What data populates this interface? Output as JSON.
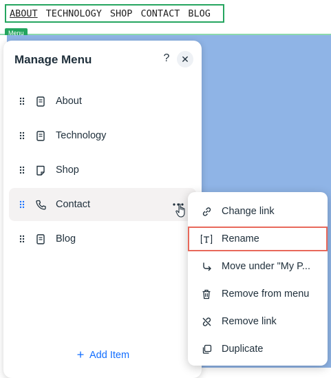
{
  "site_nav": {
    "links": [
      "ABOUT",
      "TECHNOLOGY",
      "SHOP",
      "CONTACT",
      "BLOG"
    ],
    "tag": "Menu"
  },
  "panel": {
    "title": "Manage Menu",
    "help": "?",
    "close": "✕",
    "items": [
      {
        "label": "About",
        "icon": "page-icon"
      },
      {
        "label": "Technology",
        "icon": "page-icon"
      },
      {
        "label": "Shop",
        "icon": "store-page-icon"
      },
      {
        "label": "Contact",
        "icon": "phone-icon"
      },
      {
        "label": "Blog",
        "icon": "page-icon"
      }
    ],
    "add_item": "Add Item"
  },
  "context_menu": {
    "items": [
      {
        "label": "Change link",
        "icon": "link-icon"
      },
      {
        "label": "Rename",
        "icon": "rename-icon"
      },
      {
        "label": "Move under \"My P...",
        "icon": "move-under-icon"
      },
      {
        "label": "Remove from menu",
        "icon": "trash-icon"
      },
      {
        "label": "Remove link",
        "icon": "unlink-icon"
      },
      {
        "label": "Duplicate",
        "icon": "duplicate-icon"
      }
    ]
  },
  "colors": {
    "accent": "#116dff",
    "menu_frame": "#25a55f",
    "canvas": "#8fb4e6",
    "highlight": "#e8685a"
  }
}
